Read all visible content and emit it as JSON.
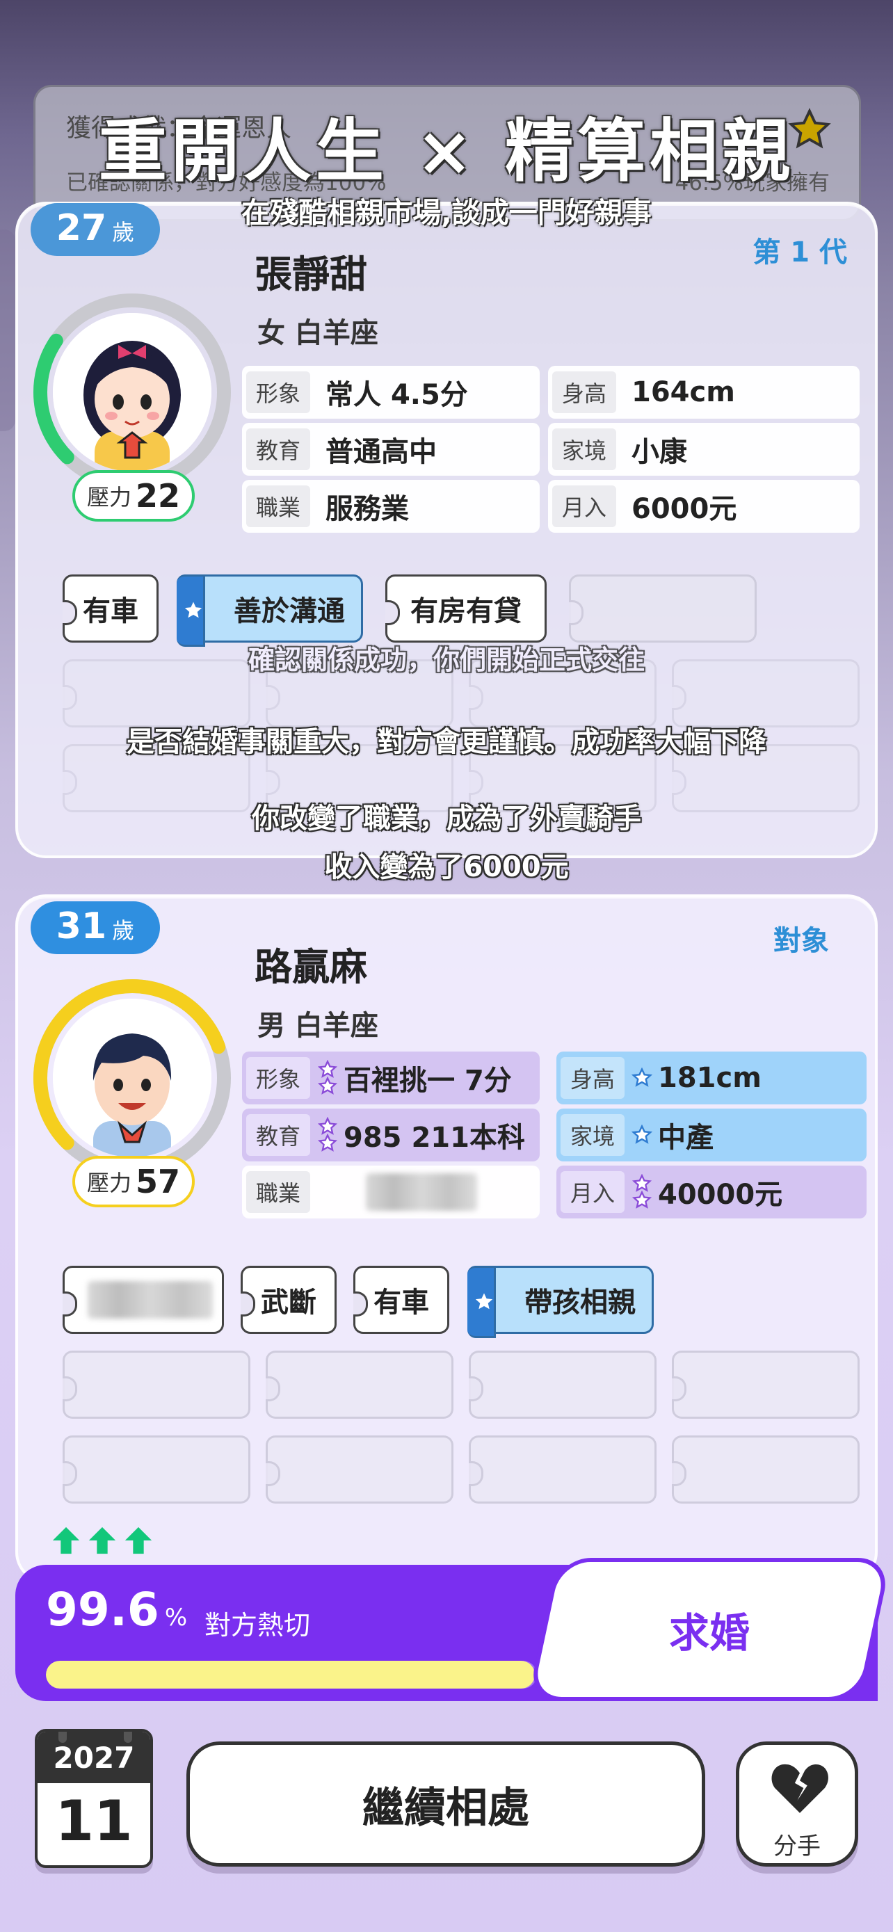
{
  "achievement": {
    "title": "獲得成就：命運恩人",
    "desc": "已確認關係，對方好感度為100%",
    "players_pct": "46.5%玩家擁有",
    "icon": "star-icon"
  },
  "overlay": {
    "title": "重開人生 × 精算相親",
    "subtitle": "在殘酷相親市場,談成一門好親事"
  },
  "self": {
    "age": "27",
    "age_unit": "歲",
    "generation": "第 1 代",
    "name": "張靜甜",
    "gender_sign": "女 白羊座",
    "pressure_label": "壓力",
    "pressure": "22",
    "pressure_level": 0.22,
    "ring_color": "#2ecc71",
    "stats": [
      {
        "key": "形象",
        "value": "常人 4.5分"
      },
      {
        "key": "身高",
        "value": "164cm"
      },
      {
        "key": "教育",
        "value": "普通高中"
      },
      {
        "key": "家境",
        "value": "小康"
      },
      {
        "key": "職業",
        "value": "服務業"
      },
      {
        "key": "月入",
        "value": "6000元"
      }
    ],
    "traits": [
      "有車",
      "善於溝通",
      "有房有貸"
    ]
  },
  "messages": {
    "m1": "確認關係成功，你們開始正式交往",
    "m2": "是否結婚事關重大，對方會更謹慎。成功率大幅下降",
    "m3": "你改變了職業，成為了外賣騎手",
    "m4": "收入變為了6000元"
  },
  "match": {
    "age": "31",
    "age_unit": "歲",
    "tag": "對象",
    "name": "路贏麻",
    "gender_sign": "男 白羊座",
    "pressure_label": "壓力",
    "pressure": "57",
    "pressure_level": 0.57,
    "ring_color": "#f5cf1e",
    "stats": [
      {
        "key": "形象",
        "value": "百裡挑一 7分"
      },
      {
        "key": "身高",
        "value": "181cm"
      },
      {
        "key": "教育",
        "value": "985 211本科"
      },
      {
        "key": "家境",
        "value": "中產"
      },
      {
        "key": "職業",
        "value": ""
      },
      {
        "key": "月入",
        "value": "40000元"
      }
    ],
    "traits": [
      "",
      "武斷",
      "有車",
      "帶孩相親"
    ]
  },
  "affection": {
    "value": "99.6",
    "unit": "%",
    "label": "對方熱切",
    "level": 0.996
  },
  "buttons": {
    "propose": "求婚",
    "continue": "繼續相處",
    "breakup": "分手"
  },
  "calendar": {
    "year": "2027",
    "month": "11"
  }
}
